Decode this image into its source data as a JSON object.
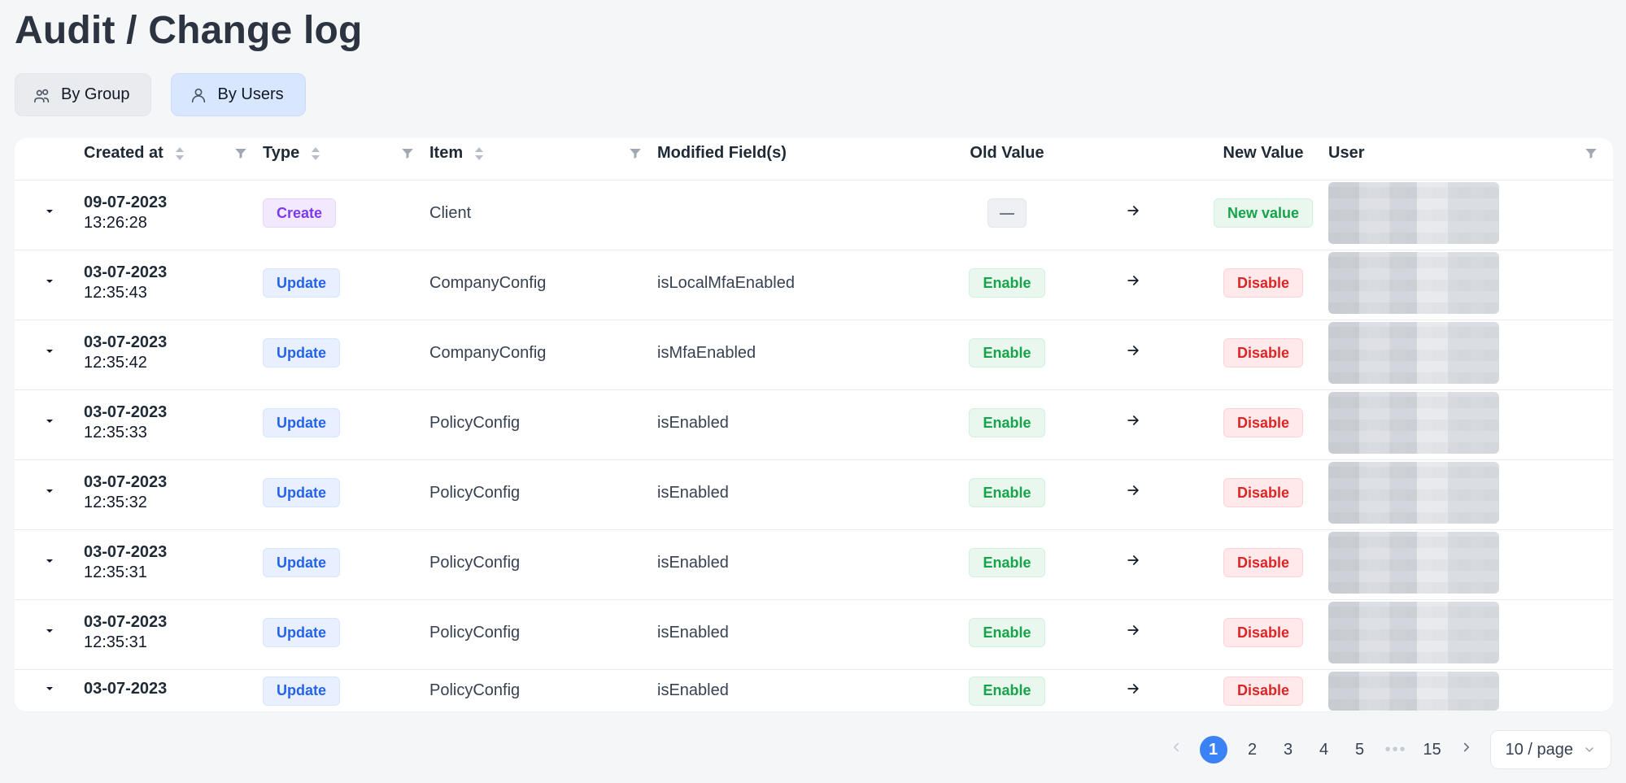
{
  "page": {
    "title": "Audit / Change log"
  },
  "toggles": [
    {
      "label": "By Group",
      "icon": "group-icon"
    },
    {
      "label": "By Users",
      "icon": "user-icon"
    }
  ],
  "table": {
    "headers": {
      "created_at": "Created at",
      "type": "Type",
      "item": "Item",
      "modified_fields": "Modified Field(s)",
      "old_value": "Old Value",
      "new_value": "New Value",
      "user": "User"
    },
    "rows": [
      {
        "date": "09-07-2023",
        "time": "13:26:28",
        "type": "Create",
        "item": "Client",
        "field": "",
        "old": "—",
        "new": "New value"
      },
      {
        "date": "03-07-2023",
        "time": "12:35:43",
        "type": "Update",
        "item": "CompanyConfig",
        "field": "isLocalMfaEnabled",
        "old": "Enable",
        "new": "Disable"
      },
      {
        "date": "03-07-2023",
        "time": "12:35:42",
        "type": "Update",
        "item": "CompanyConfig",
        "field": "isMfaEnabled",
        "old": "Enable",
        "new": "Disable"
      },
      {
        "date": "03-07-2023",
        "time": "12:35:33",
        "type": "Update",
        "item": "PolicyConfig",
        "field": "isEnabled",
        "old": "Enable",
        "new": "Disable"
      },
      {
        "date": "03-07-2023",
        "time": "12:35:32",
        "type": "Update",
        "item": "PolicyConfig",
        "field": "isEnabled",
        "old": "Enable",
        "new": "Disable"
      },
      {
        "date": "03-07-2023",
        "time": "12:35:31",
        "type": "Update",
        "item": "PolicyConfig",
        "field": "isEnabled",
        "old": "Enable",
        "new": "Disable"
      },
      {
        "date": "03-07-2023",
        "time": "12:35:31",
        "type": "Update",
        "item": "PolicyConfig",
        "field": "isEnabled",
        "old": "Enable",
        "new": "Disable"
      },
      {
        "date": "03-07-2023",
        "time": "",
        "type": "Update",
        "item": "PolicyConfig",
        "field": "isEnabled",
        "old": "Enable",
        "new": "Disable"
      }
    ]
  },
  "pagination": {
    "pages": [
      "1",
      "2",
      "3",
      "4",
      "5",
      "15"
    ],
    "dots": "•••",
    "page_size": "10 / page"
  },
  "colors": {
    "accent": "#3b82f6",
    "create": "#7c3aed",
    "update": "#2563eb",
    "enable": "#16a34a",
    "disable": "#dc2626"
  }
}
